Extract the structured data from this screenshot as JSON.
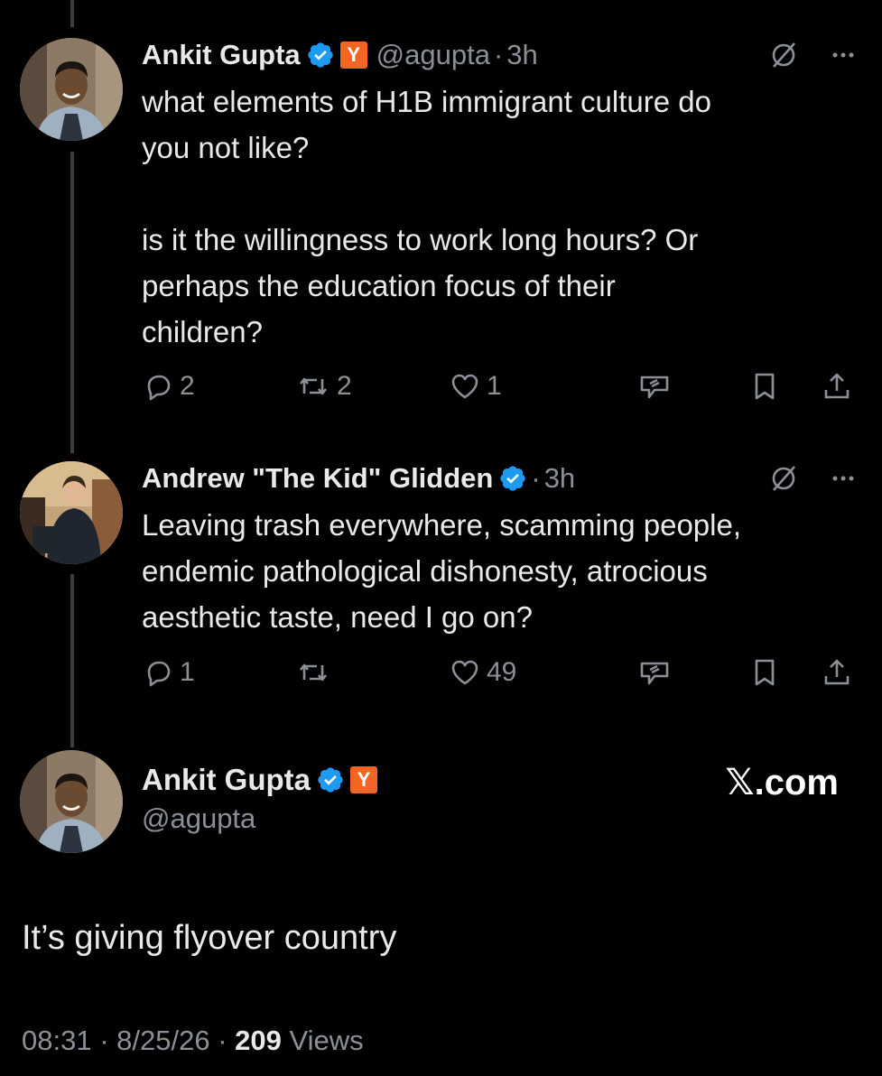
{
  "tweets": [
    {
      "name": "Ankit Gupta",
      "badge": "Y",
      "handle": "@agupta",
      "separator": "·",
      "time": "3h",
      "lines": [
        "what elements of H1B immigrant culture do",
        "you not like?",
        "",
        "is it the willingness to work long hours? Or",
        "perhaps the education focus of their",
        "children?"
      ],
      "replies": "2",
      "reposts": "2",
      "likes": "1"
    },
    {
      "name": "Andrew \"The Kid\" Glidden",
      "separator": "·",
      "time": "3h",
      "lines": [
        "Leaving trash everywhere, scamming people,",
        "endemic pathological dishonesty, atrocious",
        "aesthetic taste, need I go on?"
      ],
      "replies": "1",
      "reposts": "",
      "likes": "49"
    }
  ],
  "main_tweet": {
    "name": "Ankit Gupta",
    "badge": "Y",
    "handle": "@agupta",
    "text": "It’s giving flyover country",
    "time": "08:31",
    "date": "8/25/26",
    "separator": "·",
    "views_count": "209",
    "views_label": "Views"
  },
  "brand": "𝕏.com",
  "colors": {
    "background": "#000000",
    "text": "#e7e9ea",
    "muted": "#8b9096",
    "verified": "#1d9bf0",
    "yc_orange": "#f26522"
  },
  "icons": [
    "reply-icon",
    "repost-icon",
    "like-icon",
    "grok-icon",
    "bookmark-icon",
    "share-icon",
    "verified-icon",
    "no-entry-icon",
    "more-icon"
  ]
}
